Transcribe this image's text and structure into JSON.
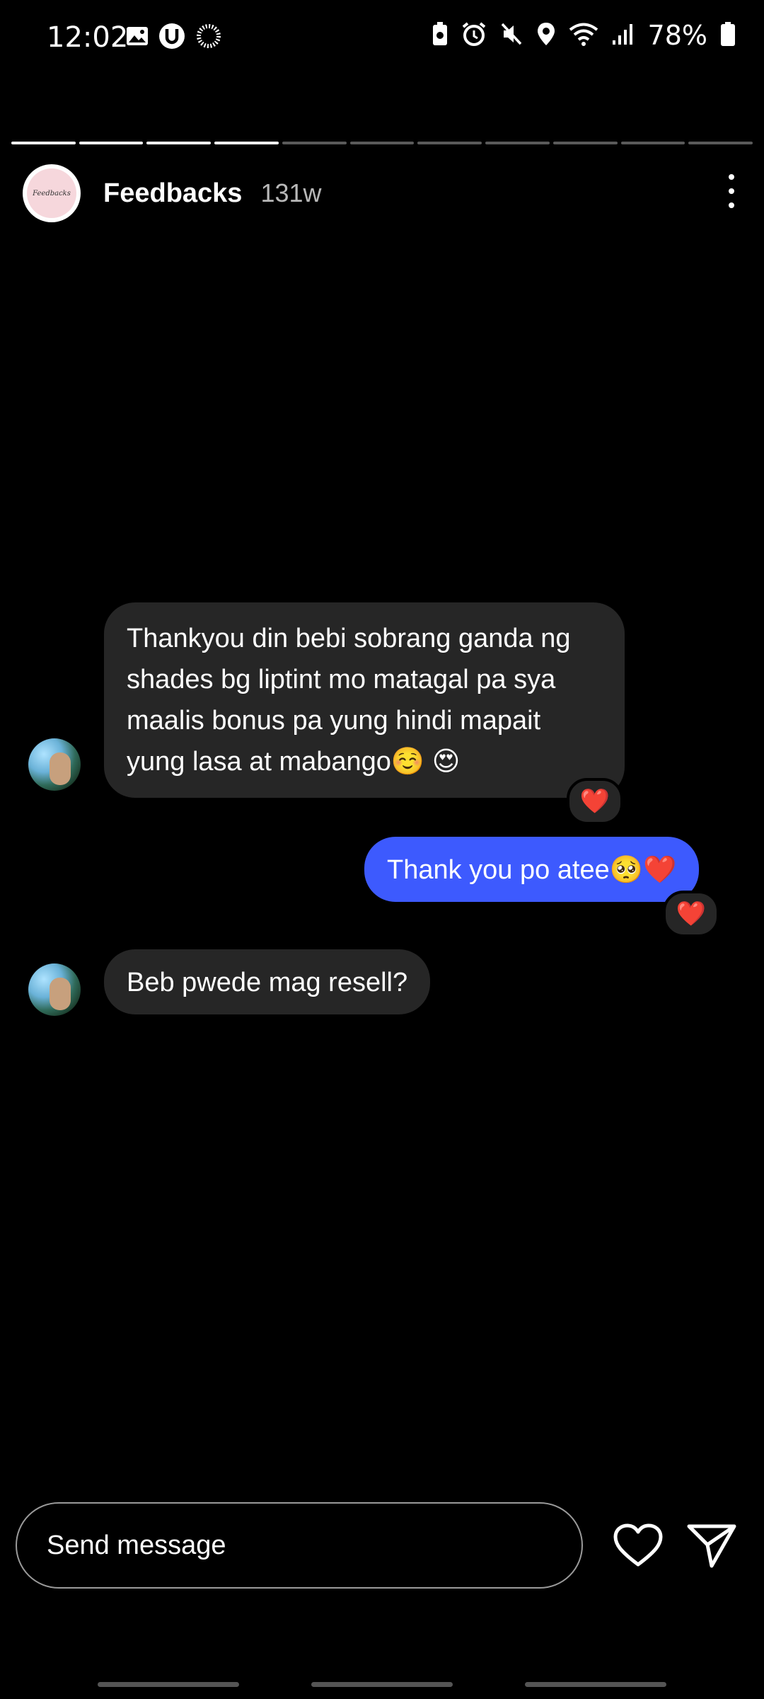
{
  "status_bar": {
    "time": "12:02",
    "battery_percent": "78%"
  },
  "story": {
    "segments_total": 11,
    "segments_completed": 4,
    "account_name": "Feedbacks",
    "avatar_text": "Feedbacks",
    "posted_ago": "131w"
  },
  "messages": {
    "m1": {
      "text": "Thankyou din bebi sobrang ganda ng shades bg liptint mo matagal pa sya maalis bonus pa yung hindi mapait yung lasa at mabango☺️ 😍",
      "reaction": "❤️"
    },
    "m2": {
      "text": "Thank you po atee🥺❤️",
      "reaction": "❤️"
    },
    "m3": {
      "text": "Beb pwede mag resell?"
    }
  },
  "composer": {
    "placeholder": "Send message"
  },
  "icons": [
    "gallery-icon",
    "u-badge-icon",
    "loading-ring-icon",
    "battery-saver-icon",
    "alarm-icon",
    "mute-icon",
    "location-icon",
    "wifi-icon",
    "signal-icon",
    "battery-icon",
    "more-icon",
    "heart-outline-icon",
    "send-icon"
  ],
  "colors": {
    "background": "#000000",
    "incoming_bubble": "#262626",
    "outgoing_bubble": "#3d5afe"
  }
}
